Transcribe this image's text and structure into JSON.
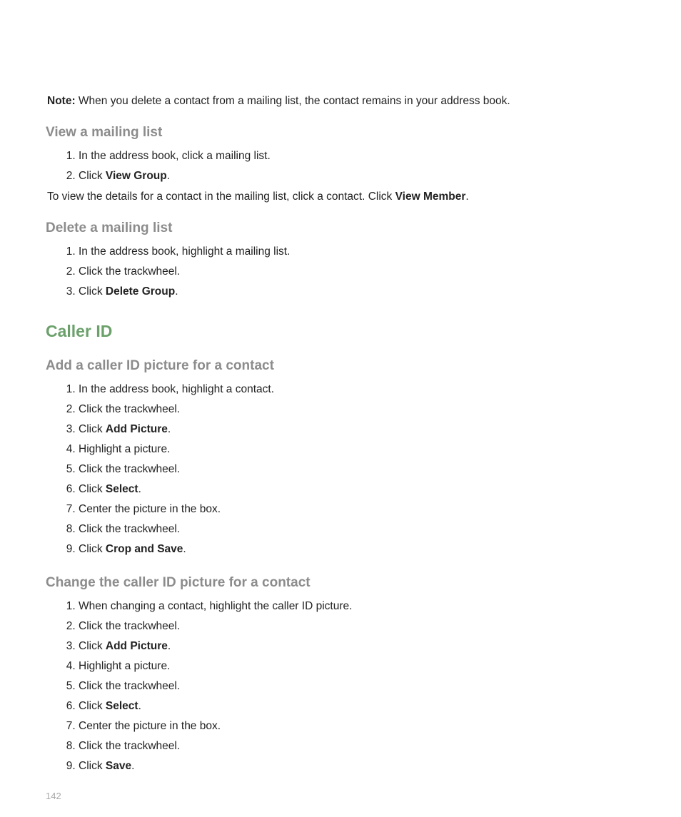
{
  "page_number": "142",
  "note": {
    "label": "Note:",
    "text": "When you delete a contact from a mailing list, the contact remains in your address book."
  },
  "sections": {
    "view_mailing": {
      "title": "View a mailing list",
      "steps": [
        {
          "pre": "In the address book, click a mailing list."
        },
        {
          "pre": "Click ",
          "bold": "View Group",
          "post": "."
        }
      ],
      "after": {
        "pre": "To view the details for a contact in the mailing list, click a contact. Click ",
        "bold": "View Member",
        "post": "."
      }
    },
    "delete_mailing": {
      "title": "Delete a mailing list",
      "steps": [
        {
          "pre": "In the address book, highlight a mailing list."
        },
        {
          "pre": "Click the trackwheel."
        },
        {
          "pre": "Click ",
          "bold": "Delete Group",
          "post": "."
        }
      ]
    },
    "caller_id_heading": "Caller ID",
    "add_caller": {
      "title": "Add a caller ID picture for a contact",
      "steps": [
        {
          "pre": "In the address book, highlight a contact."
        },
        {
          "pre": "Click the trackwheel."
        },
        {
          "pre": "Click ",
          "bold": "Add Picture",
          "post": "."
        },
        {
          "pre": "Highlight a picture."
        },
        {
          "pre": "Click the trackwheel."
        },
        {
          "pre": "Click ",
          "bold": "Select",
          "post": "."
        },
        {
          "pre": "Center the picture in the box."
        },
        {
          "pre": "Click the trackwheel."
        },
        {
          "pre": "Click ",
          "bold": "Crop and Save",
          "post": "."
        }
      ]
    },
    "change_caller": {
      "title": "Change the caller ID picture for a contact",
      "steps": [
        {
          "pre": "When changing a contact, highlight the caller ID picture."
        },
        {
          "pre": "Click the trackwheel."
        },
        {
          "pre": "Click ",
          "bold": "Add Picture",
          "post": "."
        },
        {
          "pre": "Highlight a picture."
        },
        {
          "pre": "Click the trackwheel."
        },
        {
          "pre": "Click ",
          "bold": "Select",
          "post": "."
        },
        {
          "pre": "Center the picture in the box."
        },
        {
          "pre": "Click the trackwheel."
        },
        {
          "pre": "Click ",
          "bold": "Save",
          "post": "."
        }
      ]
    }
  }
}
